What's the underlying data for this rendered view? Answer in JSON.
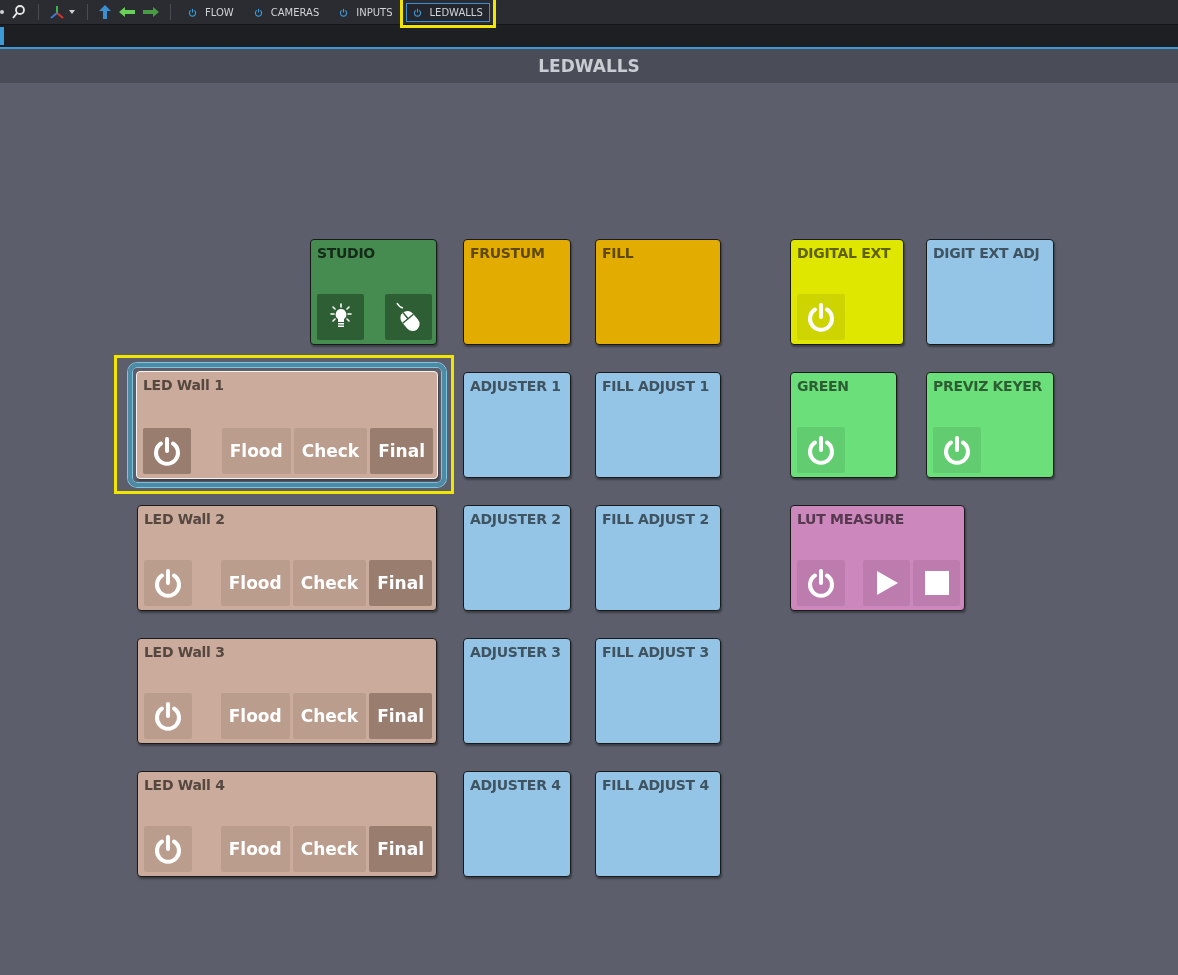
{
  "toolbar": {
    "tabs": [
      {
        "label": "FLOW",
        "selected": false
      },
      {
        "label": "CAMERAS",
        "selected": false
      },
      {
        "label": "INPUTS",
        "selected": false
      },
      {
        "label": "LEDWALLS",
        "selected": true
      }
    ]
  },
  "page_title": "LEDWALLS",
  "tiles": [
    {
      "title": "STUDIO",
      "color": "#468c50",
      "selected": false,
      "buttons": [
        {
          "kind": "light",
          "selected": true
        },
        {
          "kind": "mouse",
          "selected": true
        }
      ]
    },
    {
      "title": "FRUSTUM",
      "color": "#e2ad00",
      "selected": false
    },
    {
      "title": "FILL",
      "color": "#e2ad00",
      "selected": false
    },
    {
      "title": "DIGITAL EXT",
      "color": "#dfe600",
      "selected": false,
      "buttons": [
        {
          "kind": "power",
          "selected": false
        }
      ]
    },
    {
      "title": "DIGIT EXT ADJ",
      "color": "#95c5e6",
      "selected": false
    },
    {
      "title": "LED Wall 1",
      "color": "#cbab9b",
      "selected": true,
      "buttons": [
        {
          "kind": "power",
          "selected": true
        },
        {
          "kind": "text",
          "label": "Flood",
          "selected": false
        },
        {
          "kind": "text",
          "label": "Check",
          "selected": false
        },
        {
          "kind": "text",
          "label": "Final",
          "selected": true
        }
      ]
    },
    {
      "title": "ADJUSTER 1",
      "color": "#95c5e6",
      "selected": false
    },
    {
      "title": "FILL ADJUST 1",
      "color": "#95c5e6",
      "selected": false
    },
    {
      "title": "GREEN",
      "color": "#6adf7a",
      "selected": false,
      "buttons": [
        {
          "kind": "power",
          "selected": false
        }
      ]
    },
    {
      "title": "PREVIZ KEYER",
      "color": "#6adf7a",
      "selected": false,
      "buttons": [
        {
          "kind": "power",
          "selected": false
        }
      ]
    },
    {
      "title": "LED Wall 2",
      "color": "#cbab9b",
      "selected": false,
      "buttons": [
        {
          "kind": "power",
          "selected": false
        },
        {
          "kind": "text",
          "label": "Flood",
          "selected": false
        },
        {
          "kind": "text",
          "label": "Check",
          "selected": false
        },
        {
          "kind": "text",
          "label": "Final",
          "selected": true
        }
      ]
    },
    {
      "title": "ADJUSTER 2",
      "color": "#95c5e6",
      "selected": false
    },
    {
      "title": "FILL ADJUST 2",
      "color": "#95c5e6",
      "selected": false
    },
    {
      "title": "LUT MEASURE",
      "color": "#cc88bd",
      "selected": false,
      "buttons": [
        {
          "kind": "power",
          "selected": false
        },
        {
          "kind": "play",
          "selected": false
        },
        {
          "kind": "stop",
          "selected": false
        }
      ]
    },
    {
      "title": "LED Wall 3",
      "color": "#cbab9b",
      "selected": false,
      "buttons": [
        {
          "kind": "power",
          "selected": false
        },
        {
          "kind": "text",
          "label": "Flood",
          "selected": false
        },
        {
          "kind": "text",
          "label": "Check",
          "selected": false
        },
        {
          "kind": "text",
          "label": "Final",
          "selected": true
        }
      ]
    },
    {
      "title": "ADJUSTER 3",
      "color": "#95c5e6",
      "selected": false
    },
    {
      "title": "FILL ADJUST 3",
      "color": "#95c5e6",
      "selected": false
    },
    {
      "title": "LED Wall 4",
      "color": "#cbab9b",
      "selected": false,
      "buttons": [
        {
          "kind": "power",
          "selected": false
        },
        {
          "kind": "text",
          "label": "Flood",
          "selected": false
        },
        {
          "kind": "text",
          "label": "Check",
          "selected": false
        },
        {
          "kind": "text",
          "label": "Final",
          "selected": true
        }
      ]
    },
    {
      "title": "ADJUSTER 4",
      "color": "#95c5e6",
      "selected": false
    },
    {
      "title": "FILL ADJUST 4",
      "color": "#95c5e6",
      "selected": false
    }
  ]
}
